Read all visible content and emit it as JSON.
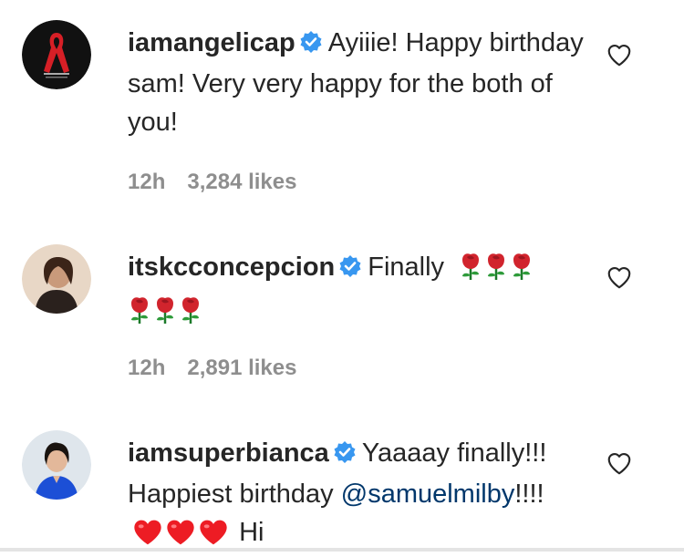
{
  "comments": [
    {
      "username": "iamangelicap",
      "text": "Ayiiie! Happy birthday sam! Very very happy for the both of you!",
      "time": "12h",
      "likes": "3,284 likes",
      "avatar_icon": "red-ribbon-logo-icon"
    },
    {
      "username": "itskcconcepcion",
      "text": "Finally",
      "emoji": [
        "rose",
        "rose",
        "rose",
        "rose",
        "rose",
        "rose"
      ],
      "time": "12h",
      "likes": "2,891 likes",
      "avatar_icon": "profile-photo"
    },
    {
      "username": "iamsuperbianca",
      "text_before": "Yaaaay finally!!! Happiest birthday",
      "mention": "@samuelmilby",
      "text_after": "!!!!",
      "emoji": [
        "red-heart",
        "red-heart",
        "red-heart"
      ],
      "text_end": "Hi",
      "avatar_icon": "profile-photo"
    }
  ],
  "colors": {
    "text": "#262626",
    "meta": "#8e8e8e",
    "verified": "#3897f0",
    "mention": "#00376b",
    "heart": "#ed1c24"
  }
}
